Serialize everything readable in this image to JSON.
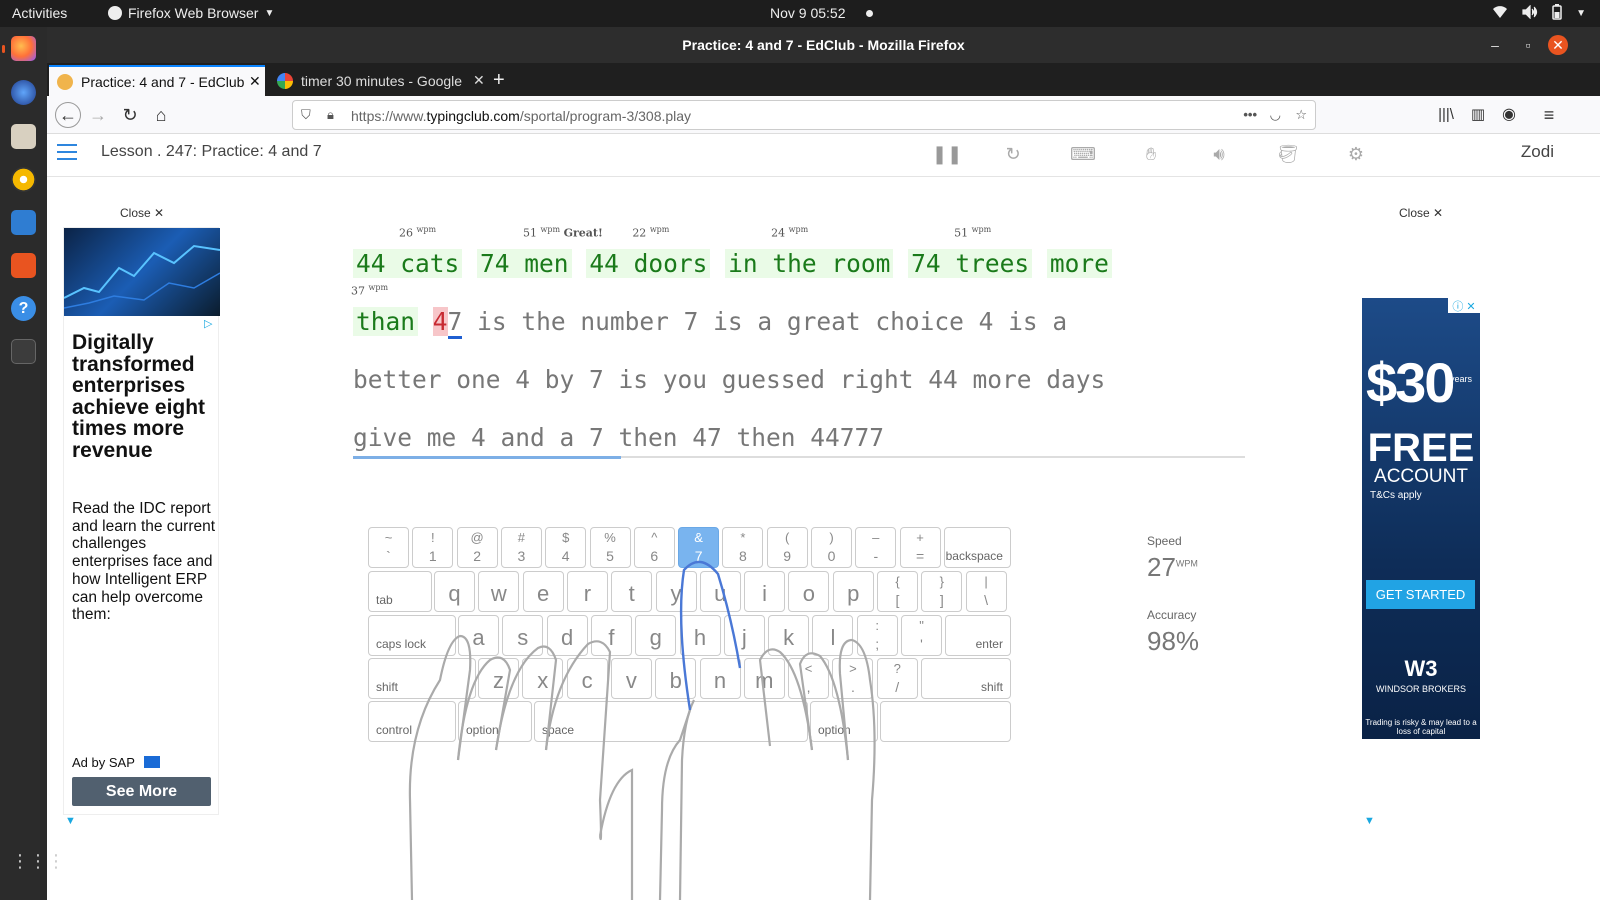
{
  "os": {
    "activities": "Activities",
    "app_menu": "Firefox Web Browser",
    "clock": "Nov 9  05:52"
  },
  "window": {
    "title": "Practice: 4 and 7 - EdClub - Mozilla Firefox"
  },
  "tabs": [
    {
      "label": "Practice: 4 and 7 - EdClub",
      "active": true
    },
    {
      "label": "timer 30 minutes - Google",
      "active": false
    }
  ],
  "navbar": {
    "url_prefix": "https://www.",
    "url_domain": "typingclub.com",
    "url_path": "/sportal/program-3/308.play"
  },
  "header": {
    "lesson_title": "Lesson . 247: Practice: 4 and 7",
    "user": "Zodi"
  },
  "ad_left": {
    "close": "Close ✕",
    "headline": "Digitally transformed enterprises achieve eight times more revenue",
    "body": "Read the IDC report and learn the current challenges enterprises face and how Intelligent ERP can help overcome them:",
    "by": "Ad by SAP",
    "cta": "See More"
  },
  "ad_right": {
    "close": "Close ✕",
    "amount": "$30",
    "years": "years",
    "free": "FREE",
    "account": "ACCOUNT",
    "tcs": "T&Cs apply",
    "cta": "GET STARTED",
    "logo": "W3",
    "brokers": "WINDSOR BROKERS",
    "risk": "Trading is risky & may lead to a loss of capital"
  },
  "typing": {
    "line1": [
      "44 cats",
      "74 men",
      "44 doors",
      "in the room",
      "74 trees",
      "more"
    ],
    "line1_wpm": [
      "26",
      "51",
      "22",
      "24",
      "51"
    ],
    "wpm_unit": "wpm",
    "great": "Great!",
    "line2_done": "than",
    "line2_wpm": "37",
    "line2_err": "4",
    "line2_cur": "7",
    "line2_rest": " is the number 7 is a great choice 4 is a",
    "line3": "better one 4 by 7 is you guessed right 44 more days",
    "line4": "give me 4 and a 7 then 47 then 44777",
    "progress": 0.3
  },
  "keyboard": {
    "row1": [
      [
        "~",
        "`"
      ],
      [
        "!",
        "1"
      ],
      [
        "@",
        "2"
      ],
      [
        "#",
        "3"
      ],
      [
        "$",
        "4"
      ],
      [
        "%",
        "5"
      ],
      [
        "^",
        "6"
      ],
      [
        "&",
        "7"
      ],
      [
        "*",
        "8"
      ],
      [
        "(",
        "9"
      ],
      [
        ")",
        "0"
      ],
      [
        "–",
        "-"
      ],
      [
        "+",
        "="
      ]
    ],
    "backspace": "backspace",
    "tab": "tab",
    "row2": [
      "q",
      "w",
      "e",
      "r",
      "t",
      "y",
      "u",
      "i",
      "o",
      "p"
    ],
    "row2_pairs": [
      [
        "{",
        "["
      ],
      [
        "}",
        "]"
      ],
      [
        "|",
        "\\"
      ]
    ],
    "caps": "caps lock",
    "row3": [
      "a",
      "s",
      "d",
      "f",
      "g",
      "h",
      "j",
      "k",
      "l"
    ],
    "row3_pairs": [
      [
        ":",
        ";"
      ],
      [
        "\"",
        "'"
      ]
    ],
    "enter": "enter",
    "shift": "shift",
    "row4": [
      "z",
      "x",
      "c",
      "v",
      "b",
      "n",
      "m"
    ],
    "row4_pairs": [
      [
        "<",
        ","
      ],
      [
        ">",
        "."
      ],
      [
        "?",
        "/"
      ]
    ],
    "control": "control",
    "option": "option",
    "space": "space",
    "highlight_key": "7"
  },
  "stats": {
    "speed_label": "Speed",
    "speed_value": "27",
    "speed_unit": "WPM",
    "accuracy_label": "Accuracy",
    "accuracy_value": "98%"
  }
}
